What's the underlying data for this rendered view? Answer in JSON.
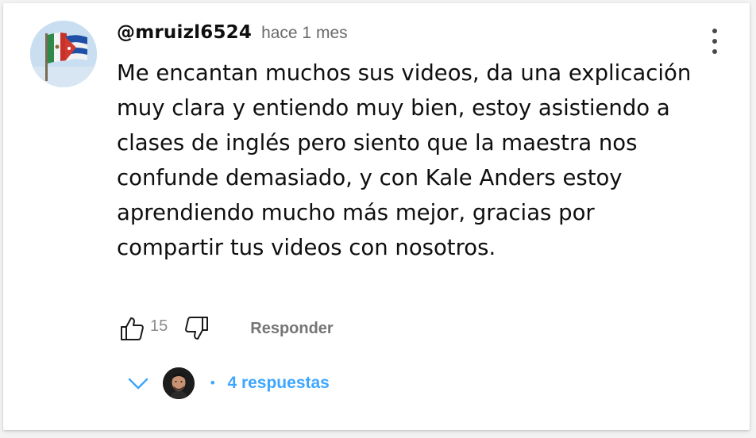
{
  "comment": {
    "author": "@mruizl6524",
    "timestamp": "hace 1 mes",
    "text": "Me encantan muchos sus videos, da una explicación muy clara y entiendo muy bien, estoy asistiendo a clases de inglés pero siento que la maestra nos confunde demasiado, y con Kale Anders estoy aprendiendo mucho más mejor, gracias por compartir tus videos con nosotros.",
    "avatar_icon": "flag-avatar"
  },
  "actions": {
    "like_icon": "thumbs-up-icon",
    "like_count": "15",
    "dislike_icon": "thumbs-down-icon",
    "reply_label": "Responder"
  },
  "menu": {
    "icon": "more-vertical-icon"
  },
  "replies": {
    "expand_icon": "chevron-down-icon",
    "separator": "•",
    "label": "4 respuestas",
    "accent_color": "#3ea6ff"
  }
}
